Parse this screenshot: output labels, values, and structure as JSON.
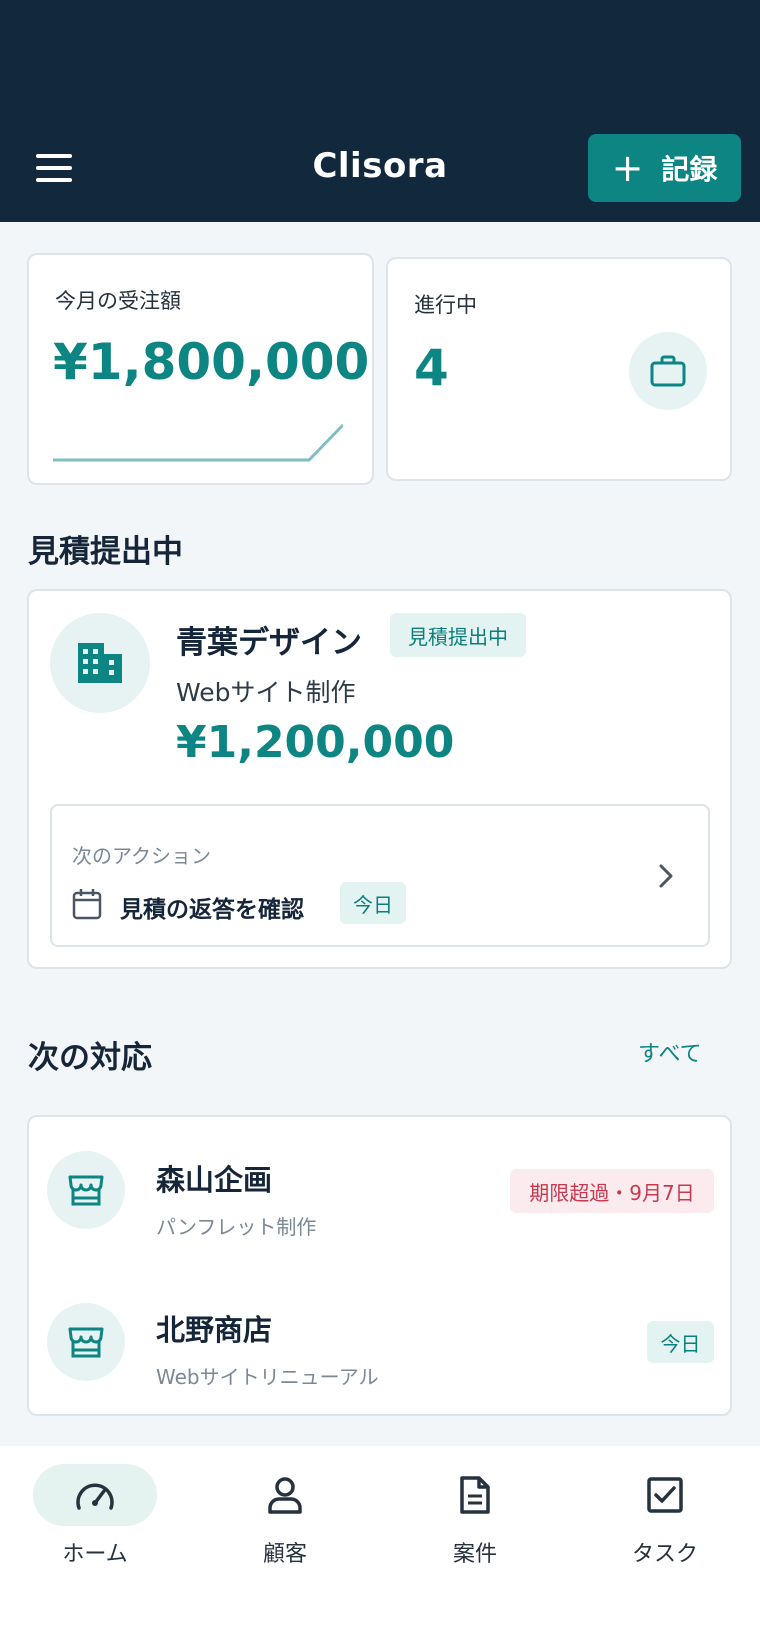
{
  "header": {
    "title": "Clisora",
    "record_label": "記録",
    "menu_icon": "hamburger-menu-icon"
  },
  "stats": {
    "monthly_orders_label": "今月の受注額",
    "monthly_orders_value": "¥1,800,000",
    "in_progress_label": "進行中",
    "in_progress_value": "4"
  },
  "quote_section": {
    "title": "見積提出中",
    "client": "青葉デザイン",
    "status": "見積提出中",
    "project": "Webサイト制作",
    "amount": "¥1,200,000",
    "next_action_label": "次のアクション",
    "next_action": "見積の返答を確認",
    "next_action_due": "今日"
  },
  "next_section": {
    "title": "次の対応",
    "see_all": "すべて",
    "items": [
      {
        "name": "森山企画",
        "project": "パンフレット制作",
        "badge": "期限超過・9月7日",
        "badge_type": "danger"
      },
      {
        "name": "北野商店",
        "project": "Webサイトリニューアル",
        "badge": "今日",
        "badge_type": "normal"
      }
    ]
  },
  "nav": {
    "items": [
      {
        "label": "ホーム",
        "icon": "speedometer-icon",
        "active": true
      },
      {
        "label": "顧客",
        "icon": "person-icon",
        "active": false
      },
      {
        "label": "案件",
        "icon": "document-icon",
        "active": false
      },
      {
        "label": "タスク",
        "icon": "checkbox-icon",
        "active": false
      }
    ]
  },
  "colors": {
    "header_bg": "#12283c",
    "accent": "#0c8583",
    "danger": "#c53a4e"
  }
}
